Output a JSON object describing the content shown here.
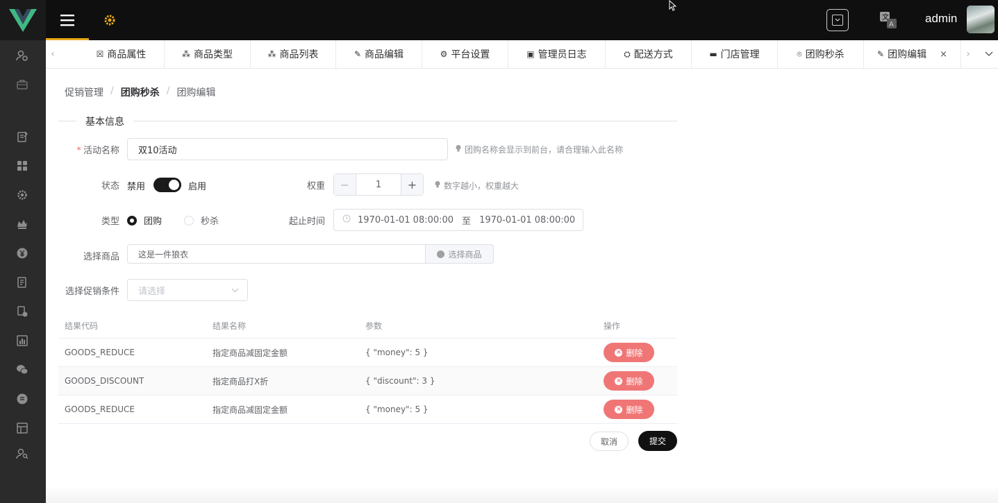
{
  "header": {
    "user_name": "admin"
  },
  "sidebar": {
    "icons": [
      "user-settings-icon",
      "briefcase-icon",
      "clipboard-icon",
      "dashboard-icon",
      "gear-icon",
      "crown-icon",
      "yen-icon",
      "document-icon",
      "coin-settings-icon",
      "chart-icon",
      "wechat-icon",
      "circle-list-icon",
      "table-icon",
      "user-search-icon"
    ]
  },
  "tabs": [
    {
      "label": "商品属性",
      "icon": "checkbox-icon",
      "active": false
    },
    {
      "label": "商品类型",
      "icon": "grid-icon",
      "active": false
    },
    {
      "label": "商品列表",
      "icon": "grid-icon",
      "active": false
    },
    {
      "label": "商品编辑",
      "icon": "pencil-icon",
      "active": false
    },
    {
      "label": "平台设置",
      "icon": "gear-icon",
      "active": false
    },
    {
      "label": "管理员日志",
      "icon": "user-log-icon",
      "active": false
    },
    {
      "label": "配送方式",
      "icon": "delivery-icon",
      "active": false
    },
    {
      "label": "门店管理",
      "icon": "store-icon",
      "active": false
    },
    {
      "label": "团购秒杀",
      "icon": "badge-icon",
      "active": false
    },
    {
      "label": "团购编辑",
      "icon": "pencil-icon",
      "active": true
    }
  ],
  "breadcrumb": {
    "level1": "促销管理",
    "level2": "团购秒杀",
    "level3": "团购编辑",
    "separator": "/"
  },
  "form": {
    "section_title": "基本信息",
    "name_label": "活动名称",
    "name_required": "*",
    "name_value": "双10活动",
    "name_hint": "团购名称会显示到前台，请合理输入此名称",
    "status_label": "状态",
    "status_off": "禁用",
    "status_on": "启用",
    "status_enabled": true,
    "weight_label": "权重",
    "weight_value": "1",
    "weight_minus": "−",
    "weight_plus": "+",
    "weight_hint": "数字越小，权重越大",
    "type_label": "类型",
    "type_option1": "团购",
    "type_option2": "秒杀",
    "type_selected": "团购",
    "time_label": "起止时间",
    "time_start": "1970-01-01 08:00:00",
    "time_sep": "至",
    "time_end": "1970-01-01 08:00:00",
    "goods_label": "选择商品",
    "goods_value": "这是一件狼衣",
    "goods_button": "选择商品",
    "condition_label": "选择促销条件",
    "condition_placeholder": "请选择"
  },
  "table": {
    "headers": [
      "结果代码",
      "结果名称",
      "参数",
      "操作"
    ],
    "rows": [
      {
        "code": "GOODS_REDUCE",
        "name": "指定商品减固定金额",
        "params": "{ \"money\": 5 }",
        "action": "删除"
      },
      {
        "code": "GOODS_DISCOUNT",
        "name": "指定商品打X折",
        "params": "{ \"discount\": 3 }",
        "action": "删除"
      },
      {
        "code": "GOODS_REDUCE",
        "name": "指定商品减固定金额",
        "params": "{ \"money\": 5 }",
        "action": "删除"
      }
    ]
  },
  "actions": {
    "cancel": "取消",
    "submit": "提交"
  },
  "colors": {
    "sidebar_bg": "#2b2b2b",
    "header_bg": "#0f0f0f",
    "accent": "#e6a817",
    "delete": "#f07676",
    "primary_button": "#111111"
  }
}
